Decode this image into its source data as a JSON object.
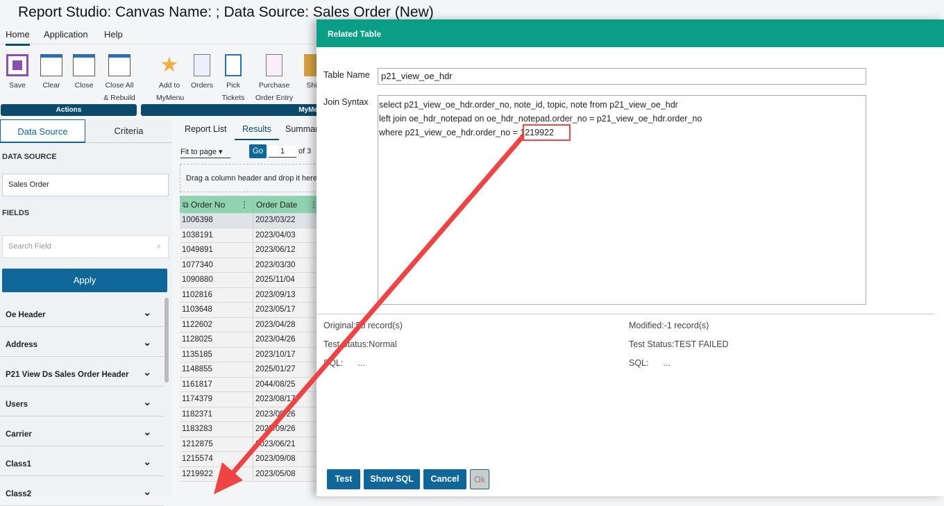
{
  "title": "Report Studio: Canvas Name: ; Data Source: Sales Order (New)",
  "menu": [
    "Home",
    "Application",
    "Help"
  ],
  "ribbon": {
    "actions": [
      {
        "label": "Save",
        "icon": "save-icon"
      },
      {
        "label": "Clear",
        "icon": "clear-icon"
      },
      {
        "label": "Close",
        "icon": "close-icon"
      },
      {
        "label": "Close All & Rebuild",
        "icon": "close-all-icon"
      }
    ],
    "mymenu": [
      {
        "label": "Add to MyMenu",
        "icon": "star-icon"
      },
      {
        "label": "Orders",
        "icon": "document-icon"
      },
      {
        "label": "Pick Tickets",
        "icon": "notebook-icon"
      },
      {
        "label": "Purchase Order Entry",
        "icon": "document-icon"
      },
      {
        "label": "Shi",
        "icon": "box-icon"
      }
    ],
    "groups": [
      "Actions",
      "MyMe"
    ]
  },
  "left": {
    "tabs": [
      "Data Source",
      "Criteria"
    ],
    "data_source_label": "DATA SOURCE",
    "data_source_value": "Sales Order",
    "fields_label": "FIELDS",
    "search_placeholder": "Search Field",
    "apply": "Apply",
    "groups": [
      "Oe Header",
      "Address",
      "P21 View Ds Sales Order Header",
      "Users",
      "Carrier",
      "Class1",
      "Class2"
    ]
  },
  "results": {
    "tabs": [
      "Report List",
      "Results",
      "Summar"
    ],
    "fit": "Fit to page",
    "go": "Go",
    "page": "1",
    "of": "of 3",
    "drag_hint": "Drag a column header and drop it here",
    "columns": [
      "Order No",
      "Order Date"
    ],
    "rows": [
      [
        "1006398",
        "2023/03/22"
      ],
      [
        "1038191",
        "2023/04/03"
      ],
      [
        "1049891",
        "2023/06/12"
      ],
      [
        "1077340",
        "2023/03/30"
      ],
      [
        "1090880",
        "2025/11/04"
      ],
      [
        "1102816",
        "2023/09/13"
      ],
      [
        "1103648",
        "2023/05/17"
      ],
      [
        "1122602",
        "2023/04/28"
      ],
      [
        "1128025",
        "2023/04/26"
      ],
      [
        "1135185",
        "2023/10/17"
      ],
      [
        "1148855",
        "2025/01/27"
      ],
      [
        "1161817",
        "2044/08/25"
      ],
      [
        "1174379",
        "2023/08/17"
      ],
      [
        "1182371",
        "2023/09/26"
      ],
      [
        "1183283",
        "2023/09/26"
      ],
      [
        "1212875",
        "2023/06/21"
      ],
      [
        "1215574",
        "2023/09/08"
      ],
      [
        "1219922",
        "2023/05/08"
      ]
    ]
  },
  "modal": {
    "title": "Related Table",
    "table_name_label": "Table Name",
    "table_name": "p21_view_oe_hdr",
    "join_label": "Join Syntax",
    "join_lines": [
      "select p21_view_oe_hdr.order_no, note_id, topic, note from p21_view_oe_hdr",
      "left join oe_hdr_notepad on oe_hdr_notepad.order_no = p21_view_oe_hdr.order_no",
      "where p21_view_oe_hdr.order_no = 1219922"
    ],
    "original": "Original:50 record(s)",
    "original_status": "Test Status:Normal",
    "original_sql": "SQL:      ...",
    "modified": "Modified:-1 record(s)",
    "modified_status": "Test Status:TEST FAILED",
    "modified_sql": "SQL:      ...",
    "buttons": [
      "Test",
      "Show SQL",
      "Cancel",
      "Ok"
    ]
  },
  "colors": {
    "teal": "#0b9e87",
    "blue": "#0f6699",
    "annotation": "#f04444"
  }
}
